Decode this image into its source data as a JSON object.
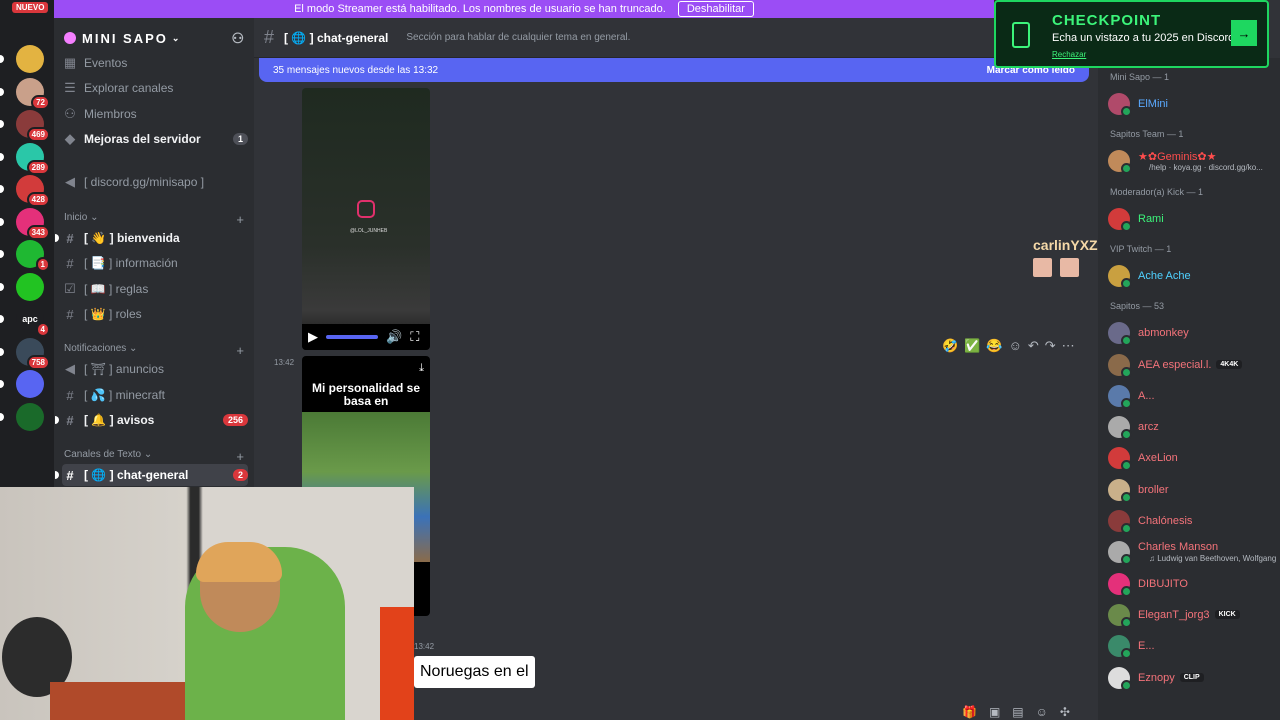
{
  "banner": {
    "text": "El modo Streamer está habilitado. Los nombres de usuario se han truncado.",
    "button": "Deshabilitar",
    "color": "#9b4df5"
  },
  "rail": {
    "new_label": "NUEVO",
    "servers": [
      {
        "color": "#e3b341",
        "badge": ""
      },
      {
        "color": "#c9a08a",
        "badge": "72"
      },
      {
        "color": "#8a3b3b",
        "badge": "469"
      },
      {
        "color": "#2ac7a8",
        "badge": "289"
      },
      {
        "color": "#d23b3b",
        "badge": "428"
      },
      {
        "color": "#e4307a",
        "badge": "343"
      },
      {
        "color": "#1fb832",
        "badge": "1"
      },
      {
        "color": "#22c322",
        "badge": ""
      },
      {
        "color": "#1e1f22",
        "badge": "4",
        "text": "apc"
      },
      {
        "color": "#3a4a5a",
        "badge": "758"
      },
      {
        "color": "#5865f2",
        "badge": ""
      },
      {
        "color": "#1a6a2a",
        "badge": ""
      }
    ]
  },
  "sidebar": {
    "server_name": "MINI SAPO",
    "items": [
      {
        "label": "Eventos",
        "icon": "calendar-icon"
      },
      {
        "label": "Explorar canales",
        "icon": "browse-icon"
      },
      {
        "label": "Miembros",
        "icon": "members-icon"
      },
      {
        "label": "Mejoras del servidor",
        "icon": "boost-icon",
        "count": "1"
      },
      {
        "label": "[ discord.gg/minisapo ]",
        "icon": "megaphone-icon"
      }
    ],
    "categories": [
      {
        "label": "Inicio",
        "channels": [
          {
            "label": "bienvenida",
            "emoji": "👋",
            "bold": true
          },
          {
            "label": "información",
            "emoji": "📑"
          },
          {
            "label": "reglas",
            "emoji": "📖"
          },
          {
            "label": "roles",
            "emoji": "👑"
          }
        ]
      },
      {
        "label": "Notificaciones",
        "channels": [
          {
            "label": "anuncios",
            "emoji": "⛩"
          },
          {
            "label": "minecraft",
            "emoji": "💦"
          },
          {
            "label": "avisos",
            "emoji": "🔔",
            "bold": true,
            "count": "256"
          }
        ]
      },
      {
        "label": "Canales de Texto",
        "channels": [
          {
            "label": "chat-general",
            "emoji": "🌐",
            "bold": true,
            "count": "2",
            "active": true
          }
        ]
      }
    ]
  },
  "chat": {
    "channel": "chat-general",
    "emoji": "🌐",
    "topic": "Sección para hablar de cualquier tema en general.",
    "new_messages": "35 mensajes nuevos desde las 13:32",
    "mark_read": "Marcar como leído",
    "video_handle": "@LOL_JUNHEB",
    "msg_time": "13:42",
    "image_caption": "Mi personalidad se basa en",
    "reactions": [
      "🤣",
      "✅",
      "😂"
    ],
    "subtitle": "Noruegas en el",
    "subtitle_time": "13:42",
    "overlay_user": "carlinYXZ :"
  },
  "promo": {
    "title": "CHECKPOINT",
    "text": "Echa un vistazo a tu 2025 en Discord",
    "dismiss": "Rechazar"
  },
  "members": {
    "groups": [
      {
        "header": "Mini Sapo — 1",
        "members": [
          {
            "name": "ElMini",
            "color": "#5aa9ff",
            "av": "#b04a6a"
          }
        ]
      },
      {
        "header": "Sapitos Team — 1",
        "members": [
          {
            "name": "★✿Geminis✿★",
            "color": "#ff4d4d",
            "av": "#c08a5a",
            "activity": "/help · koya.gg · discord.gg/ko..."
          }
        ]
      },
      {
        "header": "Moderador(a) Kick — 1",
        "members": [
          {
            "name": "Rami",
            "color": "#3cf47a",
            "av": "#d23b3b"
          }
        ]
      },
      {
        "header": "VIP Twitch — 1",
        "members": [
          {
            "name": "Ache Ache",
            "color": "#4fd1ff",
            "av": "#c9a040"
          }
        ]
      },
      {
        "header": "Sapitos — 53",
        "members": [
          {
            "name": "abmonkey",
            "color": "#f4737a",
            "av": "#6a6a8a"
          },
          {
            "name": "AEA especial.l.",
            "color": "#f4737a",
            "av": "#8a6a4a",
            "tag": "4K4K"
          },
          {
            "name": "A...",
            "color": "#f4737a",
            "av": "#5a7aaa"
          },
          {
            "name": "arcz",
            "color": "#f4737a",
            "av": "#aaaaaa"
          },
          {
            "name": "AxeLion",
            "color": "#f4737a",
            "av": "#d23b3b"
          },
          {
            "name": "broller",
            "color": "#f4737a",
            "av": "#c9b08a"
          },
          {
            "name": "Chalónesis",
            "color": "#f4737a",
            "av": "#8a3b3b"
          },
          {
            "name": "Charles Manson",
            "color": "#f4737a",
            "av": "#aaa",
            "activity": "♫ Ludwig van Beethoven, Wolfgang"
          },
          {
            "name": "DIBUJITO",
            "color": "#f4737a",
            "av": "#e4307a"
          },
          {
            "name": "EleganT_jorg3",
            "color": "#f4737a",
            "av": "#6a8a4a",
            "tag": "KICK"
          },
          {
            "name": "E...",
            "color": "#f4737a",
            "av": "#3a8a6a"
          },
          {
            "name": "Eznopy",
            "color": "#f4737a",
            "av": "#dddddd",
            "tag": "CLIP"
          }
        ]
      }
    ]
  }
}
